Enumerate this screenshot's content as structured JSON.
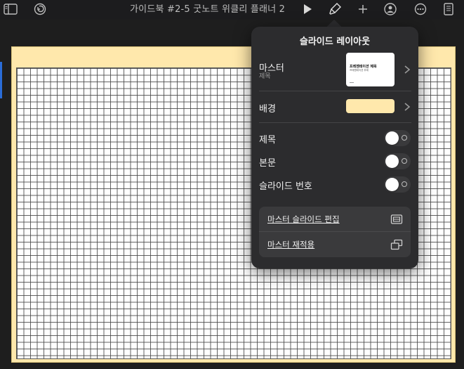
{
  "toolbar": {
    "document_title": "가이드북 #2-5 굿노트 위클리 플래너 2",
    "icons": [
      "sidebar-icon",
      "undo-icon",
      "play-icon",
      "format-brush-icon",
      "add-icon",
      "collaborate-icon",
      "more-icon",
      "document-icon"
    ]
  },
  "popover": {
    "title": "슬라이드 레이아웃",
    "master": {
      "label": "마스터",
      "sublabel": "제목",
      "thumbnail_title": "프레젠테이션 제목",
      "thumbnail_subtitle": "프레젠테이션 부제"
    },
    "background": {
      "label": "배경",
      "color": "#ffe8ac"
    },
    "toggles": [
      {
        "label": "제목",
        "on": false
      },
      {
        "label": "본문",
        "on": false
      },
      {
        "label": "슬라이드 번호",
        "on": false
      }
    ],
    "actions": [
      {
        "label": "마스터 슬라이드 편집",
        "icon": "edit-master-icon"
      },
      {
        "label": "마스터 재적용",
        "icon": "reapply-master-icon"
      }
    ]
  },
  "colors": {
    "slide_background": "#ffe8ac",
    "popover_background": "#2c2c2e",
    "selection_indicator": "#2a6cd8"
  }
}
